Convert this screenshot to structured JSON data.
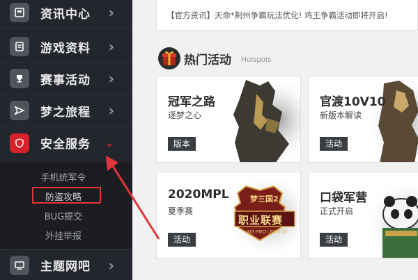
{
  "sidebar": {
    "items": [
      {
        "label": "资讯中心",
        "icon": "news-icon"
      },
      {
        "label": "游戏资料",
        "icon": "document-icon"
      },
      {
        "label": "赛事活动",
        "icon": "trophy-icon"
      },
      {
        "label": "梦之旅程",
        "icon": "send-icon"
      },
      {
        "label": "安全服务",
        "icon": "shield-icon",
        "active": true
      },
      {
        "label": "主题网吧",
        "icon": "monitor-icon"
      }
    ],
    "submenu": [
      "手机统军令",
      "防盗攻略",
      "BUG提交",
      "外挂举报"
    ],
    "highlighted_submenu": "防盗攻略",
    "active_color": "#d6202a"
  },
  "news": {
    "line2": "【官方资讯】天命*荆州争霸玩法优化! 鸡王争霸活动即将开启!"
  },
  "hotspots": {
    "title": "热门活动",
    "subtitle": "Hotspots",
    "cards": [
      {
        "title": "冠军之路",
        "subtitle": "逐梦之心",
        "tag": "版本"
      },
      {
        "title": "官渡10V10",
        "subtitle": "新版本解读",
        "tag": "活动"
      },
      {
        "title": "2020MPL",
        "subtitle": "夏季赛",
        "tag": "活动",
        "logo_text": "职业联赛",
        "logo_top": "梦三国2",
        "logo_small": "M3 PRO LEAGUE"
      },
      {
        "title": "口袋军营",
        "subtitle": "正式开启",
        "tag": "活动"
      }
    ]
  },
  "colors": {
    "sidebar_bg": "#23262d",
    "accent": "#d6202a",
    "arrow": "#e2353b"
  }
}
